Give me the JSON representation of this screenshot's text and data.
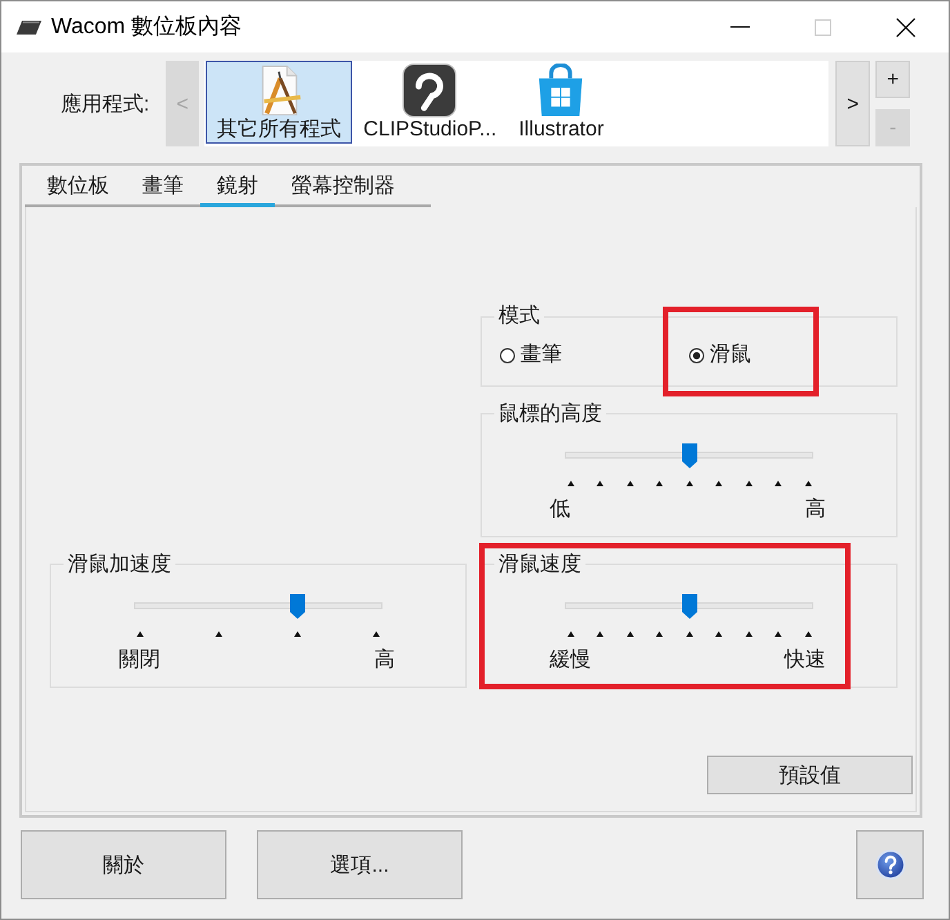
{
  "window": {
    "title": "Wacom 數位板內容",
    "maximize_disabled": true
  },
  "applications": {
    "label": "應用程式:",
    "prev": {
      "text": "<",
      "disabled": true
    },
    "next": {
      "text": ">",
      "disabled": false
    },
    "add": {
      "text": "+",
      "disabled": false
    },
    "remove": {
      "text": "-",
      "disabled": true
    },
    "items": [
      {
        "label": "其它所有程式",
        "kind": "generic",
        "selected": true
      },
      {
        "label": "CLIPStudioP...",
        "kind": "swirl",
        "selected": false
      },
      {
        "label": "Illustrator",
        "kind": "bag",
        "selected": false
      }
    ]
  },
  "tabs": [
    {
      "label": "數位板",
      "selected": false
    },
    {
      "label": "畫筆",
      "selected": false
    },
    {
      "label": "鏡射",
      "selected": true
    },
    {
      "label": "螢幕控制器",
      "selected": false
    }
  ],
  "settings": {
    "left": [
      {
        "kind": "slider",
        "title": "滑鼠加速度",
        "fine_steps": false,
        "level": 0.667,
        "min_label": "關閉",
        "max_label": "高",
        "highlighted": false
      }
    ],
    "right": [
      {
        "kind": "radio",
        "title": "模式",
        "options": [
          {
            "label": "畫筆",
            "selected": false,
            "highlighted": false
          },
          {
            "label": "滑鼠",
            "selected": true,
            "highlighted": true
          }
        ]
      },
      {
        "kind": "slider",
        "title": "鼠標的高度",
        "fine_steps": true,
        "level": 0.5,
        "min_label": "低",
        "max_label": "高",
        "highlighted": false
      },
      {
        "kind": "slider",
        "title": "滑鼠速度",
        "fine_steps": true,
        "level": 0.5,
        "min_label": "緩慢",
        "max_label": "快速",
        "highlighted": true
      }
    ]
  },
  "default_button": "預設值",
  "footer": {
    "about_button": "關於",
    "options_button": "選項..."
  }
}
